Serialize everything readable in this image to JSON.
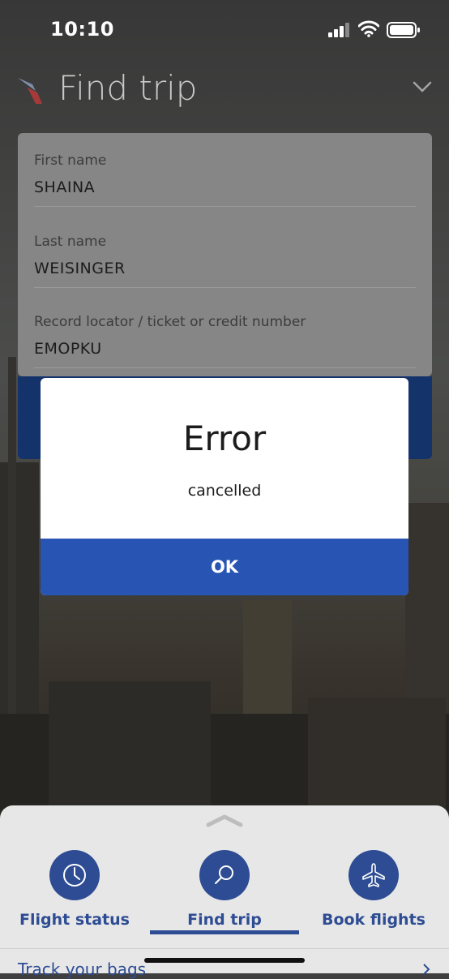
{
  "status_bar": {
    "time": "10:10"
  },
  "header": {
    "title": "Find trip"
  },
  "form": {
    "fields": [
      {
        "label": "First name",
        "value": "SHAINA"
      },
      {
        "label": "Last name",
        "value": "WEISINGER"
      },
      {
        "label": "Record locator / ticket or credit number",
        "value": "EMOPKU"
      }
    ]
  },
  "dialog": {
    "title": "Error",
    "message": "cancelled",
    "ok_label": "OK"
  },
  "bottom_nav": {
    "items": [
      {
        "label": "Flight status",
        "icon": "clock-icon"
      },
      {
        "label": "Find trip",
        "icon": "search-icon"
      },
      {
        "label": "Book flights",
        "icon": "airplane-icon"
      }
    ],
    "active_index": 1,
    "next_item_label": "Track your bags"
  },
  "colors": {
    "brand_blue": "#2d4c93",
    "button_blue": "#2855b4"
  }
}
